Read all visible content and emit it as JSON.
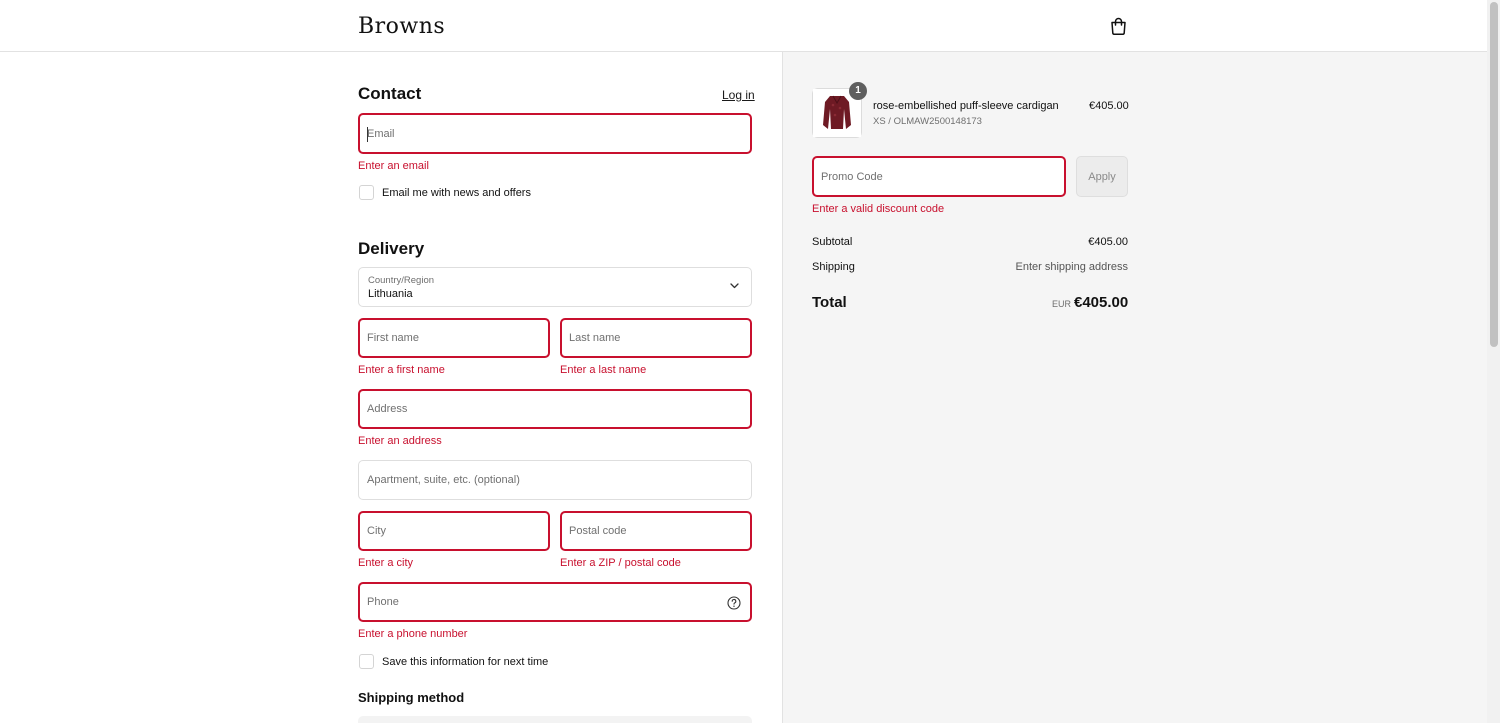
{
  "header": {
    "logo": "Browns",
    "bag_icon": "shopping-bag-icon"
  },
  "contact": {
    "title": "Contact",
    "login_link": "Log in",
    "email": {
      "placeholder": "Email",
      "value": "",
      "error": "Enter an email"
    },
    "newsletter_label": "Email me with news and offers"
  },
  "delivery": {
    "title": "Delivery",
    "country": {
      "label": "Country/Region",
      "value": "Lithuania"
    },
    "first_name": {
      "placeholder": "First name",
      "error": "Enter a first name"
    },
    "last_name": {
      "placeholder": "Last name",
      "error": "Enter a last name"
    },
    "address": {
      "placeholder": "Address",
      "error": "Enter an address"
    },
    "apartment": {
      "placeholder": "Apartment, suite, etc. (optional)"
    },
    "city": {
      "placeholder": "City",
      "error": "Enter a city"
    },
    "postal_code": {
      "placeholder": "Postal code",
      "error": "Enter a ZIP / postal code"
    },
    "phone": {
      "placeholder": "Phone",
      "error": "Enter a phone number"
    },
    "save_info_label": "Save this information for next time"
  },
  "shipping_method": {
    "title": "Shipping method"
  },
  "summary": {
    "item": {
      "quantity": "1",
      "name": "rose-embellished puff-sleeve cardigan",
      "variant": "XS / OLMAW2500148173",
      "price": "€405.00"
    },
    "promo": {
      "placeholder": "Promo Code",
      "error": "Enter a valid discount code",
      "apply_label": "Apply"
    },
    "subtotal_label": "Subtotal",
    "subtotal_value": "€405.00",
    "shipping_label": "Shipping",
    "shipping_value": "Enter shipping address",
    "total_label": "Total",
    "total_currency": "EUR",
    "total_value": "€405.00"
  },
  "colors": {
    "error": "#c8102e",
    "panel_bg": "#f5f5f5",
    "text": "#1a1a1a"
  }
}
